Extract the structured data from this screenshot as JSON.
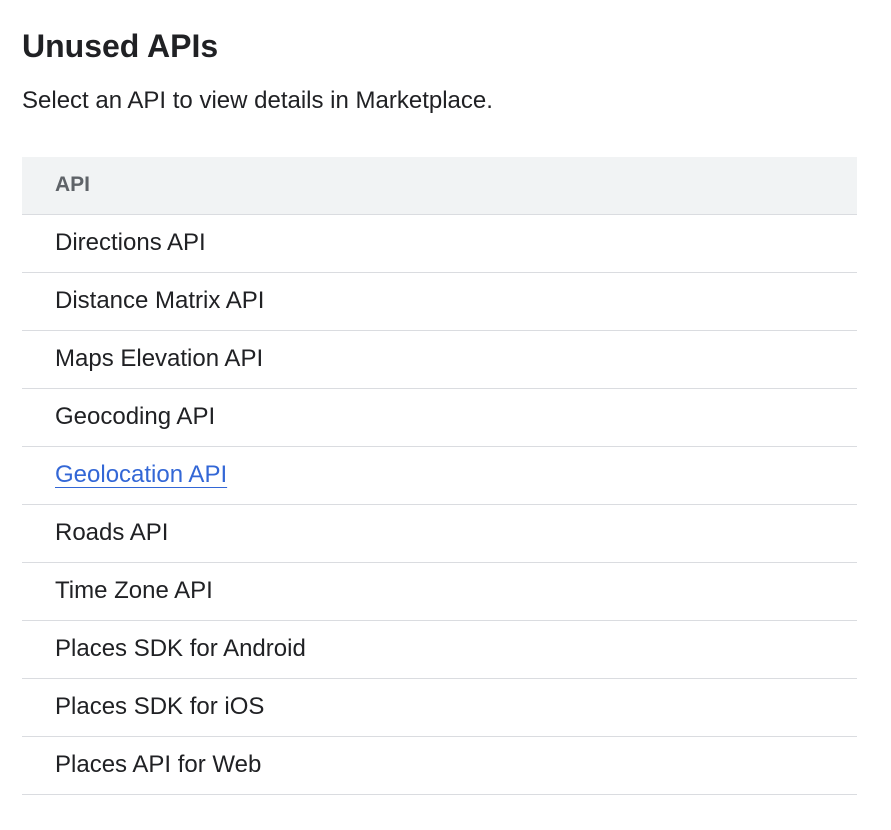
{
  "header": {
    "title": "Unused APIs",
    "subtitle": "Select an API to view details in Marketplace."
  },
  "table": {
    "column_header": "API",
    "rows": [
      {
        "label": "Directions API",
        "hovered": false
      },
      {
        "label": "Distance Matrix API",
        "hovered": false
      },
      {
        "label": "Maps Elevation API",
        "hovered": false
      },
      {
        "label": "Geocoding API",
        "hovered": false
      },
      {
        "label": "Geolocation API",
        "hovered": true
      },
      {
        "label": "Roads API",
        "hovered": false
      },
      {
        "label": "Time Zone API",
        "hovered": false
      },
      {
        "label": "Places SDK for Android",
        "hovered": false
      },
      {
        "label": "Places SDK for iOS",
        "hovered": false
      },
      {
        "label": "Places API for Web",
        "hovered": false
      }
    ]
  },
  "colors": {
    "link_hover": "#3367d6",
    "header_bg": "#f1f3f4",
    "divider": "#dadce0"
  }
}
